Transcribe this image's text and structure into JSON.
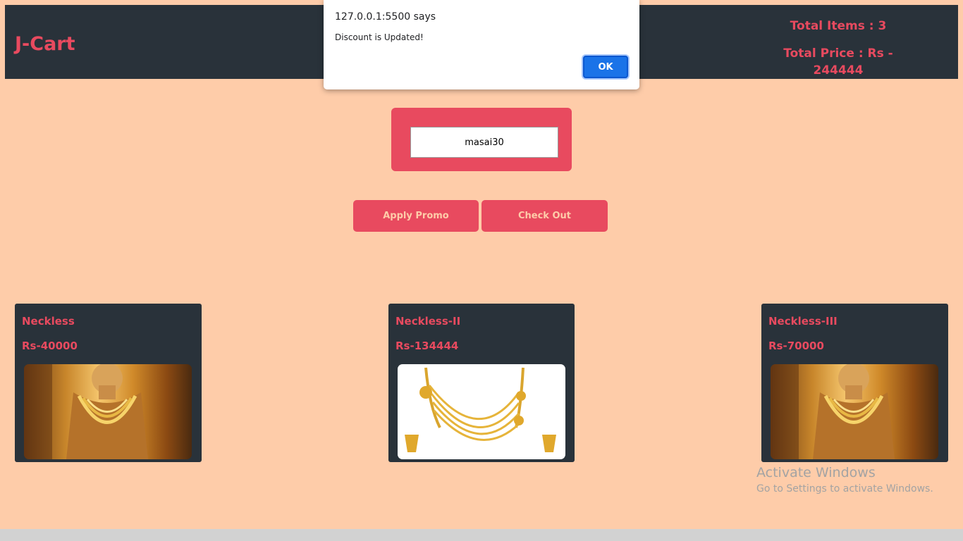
{
  "navbar": {
    "brand": "J-Cart",
    "total_items": "Total Items : 3",
    "total_price": "Total Price : Rs - 244444"
  },
  "promo": {
    "input_value": "masai30"
  },
  "buttons": {
    "apply_promo": "Apply Promo",
    "check_out": "Check Out"
  },
  "products": [
    {
      "name": "Neckless",
      "price": "Rs-40000",
      "image": "gold-necklace-mannequin-image"
    },
    {
      "name": "Neckless-II",
      "price": "Rs-134444",
      "image": "gold-layered-necklace-image"
    },
    {
      "name": "Neckless-III",
      "price": "Rs-70000",
      "image": "gold-necklace-mannequin-image"
    }
  ],
  "alert": {
    "origin": "127.0.0.1:5500 says",
    "message": "Discount is Updated!",
    "ok_label": "OK"
  },
  "watermark": {
    "line1": "Activate Windows",
    "line2": "Go to Settings to activate Windows."
  },
  "colors": {
    "page_bg": "#fecca9",
    "navbar_bg": "#29323a",
    "accent": "#e84a5f",
    "dialog_button": "#1a73e8"
  }
}
